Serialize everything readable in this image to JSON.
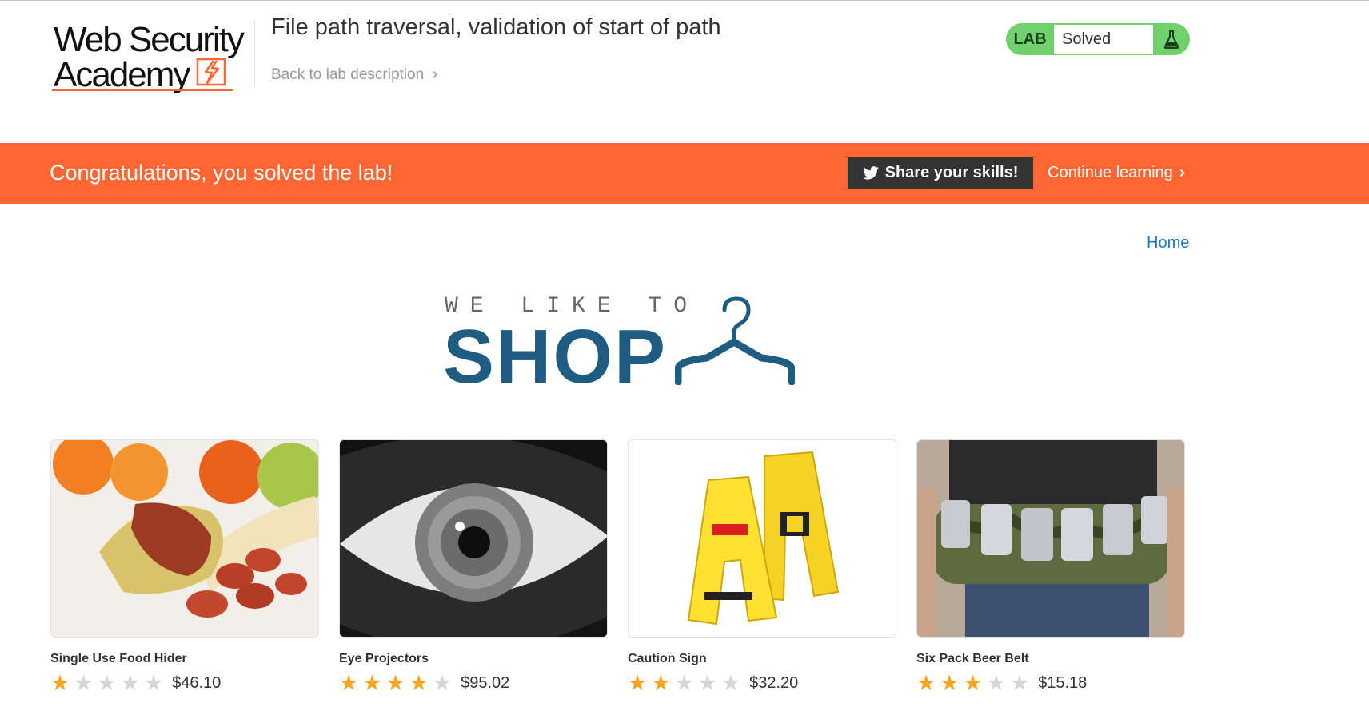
{
  "header": {
    "logo_line1": "Web Security",
    "logo_line2": "Academy",
    "lab_title": "File path traversal, validation of start of path",
    "back_link": "Back to lab description",
    "lab_tag": "LAB",
    "lab_status": "Solved"
  },
  "banner": {
    "message": "Congratulations, you solved the lab!",
    "share_label": "Share your skills!",
    "continue_label": "Continue learning"
  },
  "nav": {
    "home": "Home"
  },
  "shop_logo": {
    "top": "WE LIKE TO",
    "big": "SHOP"
  },
  "products": [
    {
      "name": "Single Use Food Hider",
      "rating": 1,
      "price": "$46.10"
    },
    {
      "name": "Eye Projectors",
      "rating": 4,
      "price": "$95.02"
    },
    {
      "name": "Caution Sign",
      "rating": 2,
      "price": "$32.20"
    },
    {
      "name": "Six Pack Beer Belt",
      "rating": 3,
      "price": "$15.18"
    }
  ],
  "colors": {
    "accent": "#ff6633",
    "lab_green": "#70d16d",
    "shop_blue": "#1e5c82",
    "link_blue": "#1a77c9",
    "star": "#f5a623"
  }
}
